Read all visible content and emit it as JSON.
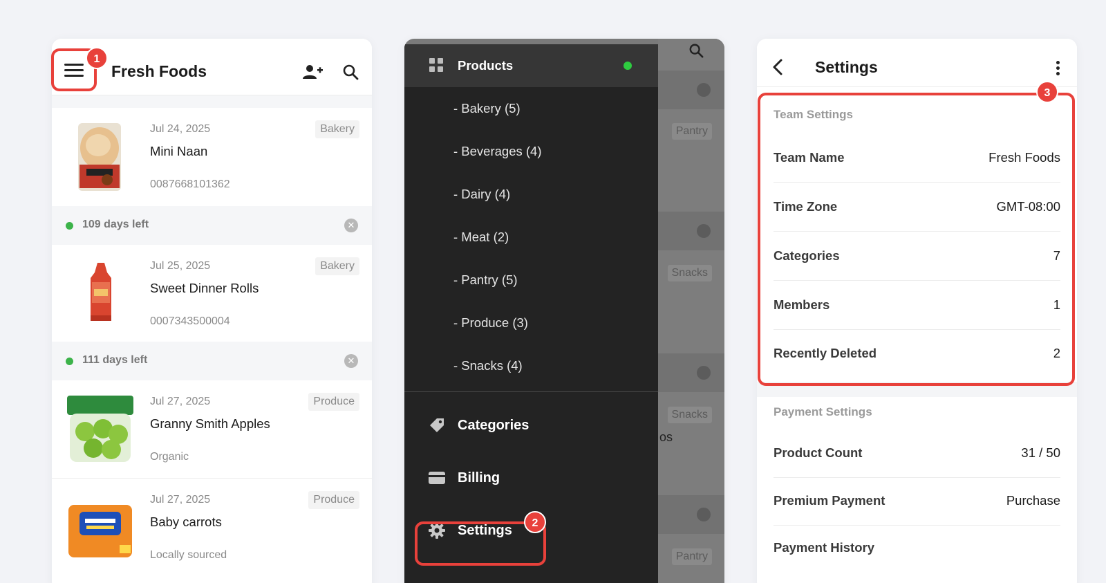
{
  "colors": {
    "accent_red": "#e8413b",
    "status_green": "#3cb34a",
    "drawer_bg": "#232323"
  },
  "panel1": {
    "title": "Fresh Foods",
    "badge": "1",
    "items": [
      {
        "date": "Jul 24, 2025",
        "name": "Mini Naan",
        "sub": "0087668101362",
        "category": "Bakery"
      },
      {
        "date": "Jul 25, 2025",
        "name": "Sweet Dinner Rolls",
        "sub": "0007343500004",
        "category": "Bakery"
      },
      {
        "date": "Jul 27, 2025",
        "name": "Granny Smith Apples",
        "sub": "Organic",
        "category": "Produce"
      },
      {
        "date": "Jul 27, 2025",
        "name": "Baby carrots",
        "sub": "Locally sourced",
        "category": "Produce"
      }
    ],
    "days": [
      "109 days left",
      "111 days left"
    ],
    "close_glyph": "✕"
  },
  "panel2": {
    "products_label": "Products",
    "categories": [
      "- Bakery (5)",
      "- Beverages (4)",
      "- Dairy (4)",
      "- Meat (2)",
      "- Pantry (5)",
      "- Produce (3)",
      "- Snacks (4)"
    ],
    "menu": {
      "categories": "Categories",
      "billing": "Billing",
      "settings": "Settings"
    },
    "badge": "2",
    "bg_tags": [
      "Pantry",
      "Snacks",
      "Snacks",
      "Pantry"
    ],
    "bg_fragment": "os"
  },
  "panel3": {
    "title": "Settings",
    "badge": "3",
    "team_section": "Team Settings",
    "team_rows": [
      {
        "label": "Team Name",
        "value": "Fresh Foods"
      },
      {
        "label": "Time Zone",
        "value": "GMT-08:00"
      },
      {
        "label": "Categories",
        "value": "7"
      },
      {
        "label": "Members",
        "value": "1"
      },
      {
        "label": "Recently Deleted",
        "value": "2"
      }
    ],
    "payment_section": "Payment Settings",
    "payment_rows": [
      {
        "label": "Product Count",
        "value": "31 / 50"
      },
      {
        "label": "Premium Payment",
        "value": "Purchase"
      },
      {
        "label": "Payment History",
        "value": ""
      }
    ]
  }
}
